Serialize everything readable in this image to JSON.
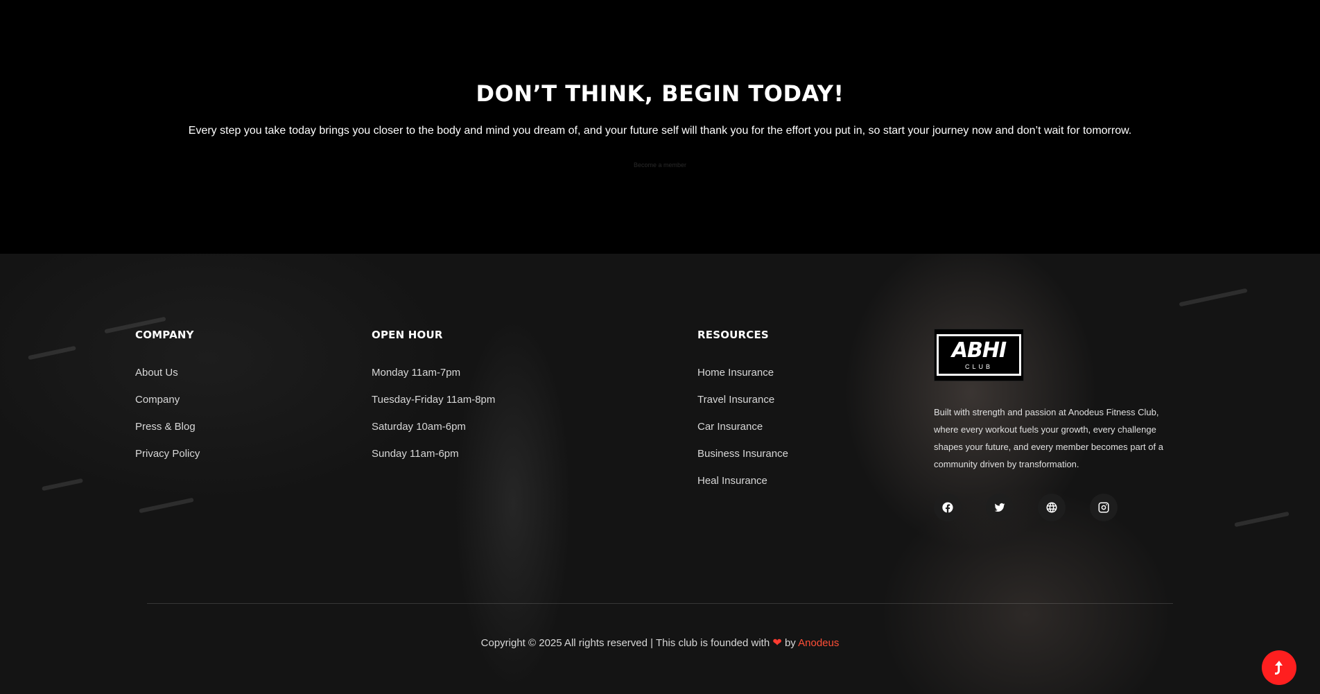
{
  "cta": {
    "title": "DON’T THINK, BEGIN TODAY!",
    "text": "Every step you take today brings you closer to the body and mind you dream of, and your future self will thank you for the effort you put in, so start your journey now and don’t wait for tomorrow.",
    "button_label": "Become a member"
  },
  "footer": {
    "company": {
      "heading": "COMPANY",
      "items": [
        "About Us",
        "Company",
        "Press & Blog",
        "Privacy Policy"
      ]
    },
    "hours": {
      "heading": "OPEN HOUR",
      "items": [
        "Monday 11am-7pm",
        "Tuesday-Friday 11am-8pm",
        "Saturday 10am-6pm",
        "Sunday 11am-6pm"
      ]
    },
    "resources": {
      "heading": "RESOURCES",
      "items": [
        "Home Insurance",
        "Travel Insurance",
        "Car Insurance",
        "Business Insurance",
        "Heal Insurance"
      ]
    },
    "brand": {
      "logo_main": "ABHI",
      "logo_sub": "CLUB",
      "description": "Built with strength and passion at Anodeus Fitness Club, where every workout fuels your growth, every challenge shapes your future, and every member becomes part of a community driven by transformation.",
      "socials": [
        "facebook-icon",
        "twitter-icon",
        "globe-icon",
        "instagram-icon"
      ]
    },
    "copyright": {
      "prefix": "Copyright © 2025 All rights reserved | This club is founded with",
      "heart": "❤",
      "by": "by",
      "author": "Anodeus"
    }
  },
  "colors": {
    "accent": "#ff1f1f",
    "author_link": "#ff4f37",
    "background": "#000000"
  }
}
